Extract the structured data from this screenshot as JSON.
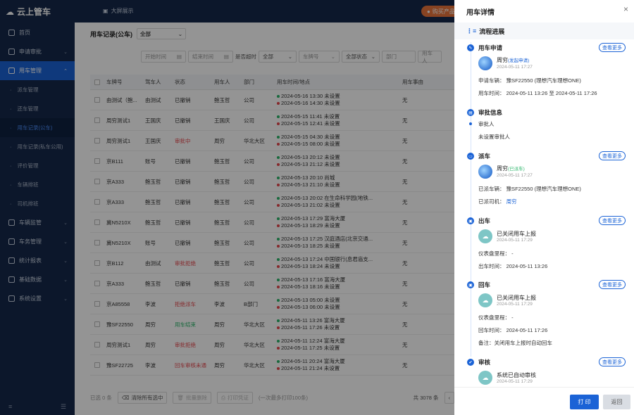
{
  "app": {
    "name": "云上管车",
    "bigscreen": "大屏展示",
    "buy": "购买产品"
  },
  "sidebar": {
    "items": [
      {
        "label": "首页",
        "icon": "home-icon"
      },
      {
        "label": "申请审批",
        "icon": "user-icon"
      },
      {
        "label": "用车管理",
        "icon": "car-icon"
      }
    ],
    "subitems": [
      "派车管理",
      "还车管理",
      "用车记录(公车)",
      "用车记录(私车公用)",
      "评价管理",
      "车辆排班",
      "司机排班"
    ],
    "items2": [
      {
        "label": "车辆监管",
        "icon": "car-icon"
      },
      {
        "label": "车务管理",
        "icon": "folder-icon"
      },
      {
        "label": "统计报表",
        "icon": "chart-icon"
      },
      {
        "label": "基础数据",
        "icon": "database-icon"
      },
      {
        "label": "系统设置",
        "icon": "gear-icon"
      }
    ]
  },
  "main": {
    "title": "用车记录(公车)",
    "scope": "全部",
    "filters": {
      "start": "开始时间",
      "end": "结束时间",
      "overdue_label": "是否超时",
      "overdue": "全部",
      "plate": "车牌号",
      "status": "全部状态",
      "dept": "部门",
      "user": "用车人"
    },
    "columns": [
      "车牌号",
      "驾车人",
      "状态",
      "用车人",
      "部门",
      "用车时间/地点",
      "用车事由"
    ],
    "rows": [
      {
        "plate": "由测试（鲍...",
        "driver": "由测试",
        "status": "已撤销",
        "sc": "",
        "user": "鲍玉哲",
        "dept": "公司",
        "t1": "2024-05-16 13:30 未设置",
        "t2": "2024-05-16 14:30 未设置",
        "reason": "无"
      },
      {
        "plate": "周穷测试1",
        "driver": "王国庆",
        "status": "已撤销",
        "sc": "",
        "user": "王国庆",
        "dept": "公司",
        "t1": "2024-05-15 11:41 未设置",
        "t2": "2024-05-15 12:41 未设置",
        "reason": "无"
      },
      {
        "plate": "周穷测试1",
        "driver": "王国庆",
        "status": "审批中",
        "sc": "red",
        "user": "周穷",
        "dept": "华北大区",
        "t1": "2024-05-15 04:30 未设置",
        "t2": "2024-05-15 08:00 未设置",
        "reason": "无"
      },
      {
        "plate": "京B111",
        "driver": "账号",
        "status": "已撤销",
        "sc": "",
        "user": "鲍玉哲",
        "dept": "公司",
        "t1": "2024-05-13 20:12 未设置",
        "t2": "2024-05-13 21:12 未设置",
        "reason": "无"
      },
      {
        "plate": "京A333",
        "driver": "鲍玉哲",
        "status": "已撤销",
        "sc": "",
        "user": "鲍玉哲",
        "dept": "公司",
        "t1": "2024-05-13 20:10 尚城",
        "t2": "2024-05-13 21:10 未设置",
        "reason": "无"
      },
      {
        "plate": "京A333",
        "driver": "鲍玉哲",
        "status": "已撤销",
        "sc": "",
        "user": "鲍玉哲",
        "dept": "公司",
        "t1": "2024-05-13 20:02 在生命科学园(地铁...",
        "t2": "2024-05-13 21:02 未设置",
        "reason": "无"
      },
      {
        "plate": "冀N5210X",
        "driver": "鲍玉哲",
        "status": "已撤销",
        "sc": "",
        "user": "鲍玉哲",
        "dept": "公司",
        "t1": "2024-05-13 17:29 富海大厦",
        "t2": "2024-05-13 18:29 未设置",
        "reason": "无"
      },
      {
        "plate": "冀N5210X",
        "driver": "账号",
        "status": "已撤销",
        "sc": "",
        "user": "鲍玉哲",
        "dept": "公司",
        "t1": "2024-05-13 17:25 汉庭酒店(北京交通...",
        "t2": "2024-05-13 18:25 未设置",
        "reason": "无"
      },
      {
        "plate": "京B112",
        "driver": "由测试",
        "status": "审批拒绝",
        "sc": "red",
        "user": "鲍玉哲",
        "dept": "公司",
        "t1": "2024-05-13 17:24 中国银行(息君庙支...",
        "t2": "2024-05-13 18:24 未设置",
        "reason": "无"
      },
      {
        "plate": "京A333",
        "driver": "鲍玉哲",
        "status": "已撤销",
        "sc": "",
        "user": "鲍玉哲",
        "dept": "公司",
        "t1": "2024-05-13 17:16 富海大厦",
        "t2": "2024-05-13 18:16 未设置",
        "reason": "无"
      },
      {
        "plate": "京A85558",
        "driver": "李波",
        "status": "拒绝派车",
        "sc": "red",
        "user": "李波",
        "dept": "B部门",
        "t1": "2024-05-13 05:00 未设置",
        "t2": "2024-05-13 06:00 未设置",
        "reason": "无"
      },
      {
        "plate": "豫SF22550",
        "driver": "周穷",
        "status": "用车结束",
        "sc": "green",
        "user": "周穷",
        "dept": "华北大区",
        "t1": "2024-05-11 13:26 富海大厦",
        "t2": "2024-05-11 17:26 未设置",
        "reason": "无"
      },
      {
        "plate": "周穷测试1",
        "driver": "周穷",
        "status": "审批拒绝",
        "sc": "red",
        "user": "周穷",
        "dept": "华北大区",
        "t1": "2024-05-11 12:24 富海大厦",
        "t2": "2024-05-11 17:25 未设置",
        "reason": "无"
      },
      {
        "plate": "豫SF22725",
        "driver": "李波",
        "status": "回车审核未通",
        "sc": "red",
        "user": "周穷",
        "dept": "华北大区",
        "t1": "2024-05-11 20:24 富海大厦",
        "t2": "2024-05-11 21:24 未设置",
        "reason": "无"
      }
    ],
    "footer": {
      "selected": "已选 0 条",
      "clear": "清除所有选中",
      "batch_delete": "批量删除",
      "print": "打印凭证",
      "print_hint": "(一次最多打印100条)",
      "total": "共 3078 条"
    }
  },
  "drawer": {
    "title": "用车详情",
    "tab": "流程进展",
    "more": "查看更多",
    "apply": {
      "title": "用车申请",
      "name": "周穷",
      "tag": "(发起申请)",
      "time": "2024-05-11 17:27",
      "car": "申请车辆： 豫SF22550 (理想汽车理想ONE)",
      "usetime": "用车时间： 2024-05-11 13:26 至 2024-05-11 17:26"
    },
    "approve": {
      "title": "审批信息",
      "approver": "审批人",
      "none": "未设置审批人"
    },
    "dispatch": {
      "title": "派车",
      "name": "周穷",
      "tag": "(已派车)",
      "time": "2024-05-11 17:27",
      "car": "已派车辆： 豫SF22550 (理想汽车理想ONE)",
      "driver_label": "已派司机：",
      "driver": "周穷"
    },
    "out": {
      "title": "出车",
      "msg": "已关闭用车上报",
      "time": "2024-05-11 17:29",
      "odo": "仪表盘里程：  -",
      "outtime": "出车时间： 2024-05-11 13:26"
    },
    "back": {
      "title": "回车",
      "msg": "已关闭用车上报",
      "time": "2024-05-11 17:29",
      "odo": "仪表盘里程：  -",
      "backtime": "回车时间： 2024-05-11 17:26",
      "note": "备注：关闭用车上报时自动回车"
    },
    "audit": {
      "title": "审核",
      "msg": "系统已自动审核",
      "time": "2024-05-11 17:29"
    },
    "print": "打 印",
    "back_btn": "返回"
  }
}
